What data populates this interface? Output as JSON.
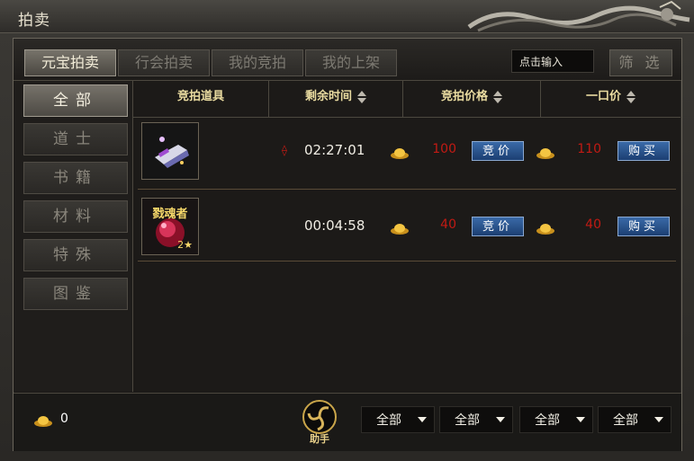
{
  "window": {
    "title": "拍卖"
  },
  "tabs": [
    {
      "label": "元宝拍卖",
      "active": true
    },
    {
      "label": "行会拍卖",
      "active": false
    },
    {
      "label": "我的竞拍",
      "active": false
    },
    {
      "label": "我的上架",
      "active": false
    }
  ],
  "search": {
    "placeholder": "点击输入"
  },
  "filter_label": "筛 选",
  "categories": [
    {
      "label": "全部",
      "active": true
    },
    {
      "label": "道士",
      "active": false
    },
    {
      "label": "书籍",
      "active": false
    },
    {
      "label": "材料",
      "active": false
    },
    {
      "label": "特殊",
      "active": false
    },
    {
      "label": "图鉴",
      "active": false
    }
  ],
  "columns": {
    "item": "竞拍道具",
    "time": "剩余时间",
    "bid": "竞拍价格",
    "buyout": "一口价"
  },
  "rows": [
    {
      "item_icon": "spaceship-item-icon",
      "item_label": "",
      "item_stars": "",
      "time": "02:27:01",
      "bid_price": "100",
      "bid_button": "竞价",
      "buyout_price": "110",
      "buy_button": "购买",
      "has_marker": true
    },
    {
      "item_icon": "red-soul-gem-icon",
      "item_label": "戮魂者",
      "item_stars": "2★",
      "time": "00:04:58",
      "bid_price": "40",
      "bid_button": "竞价",
      "buyout_price": "40",
      "buy_button": "购买",
      "has_marker": false
    }
  ],
  "footer": {
    "currency_amount": "0",
    "helper_label": "助手",
    "dropdowns": [
      "全部",
      "全部",
      "全部",
      "全部"
    ]
  },
  "colors": {
    "price_red": "#c21a14",
    "header_gold": "#e9dba0",
    "button_blue": "#1c3f72"
  }
}
